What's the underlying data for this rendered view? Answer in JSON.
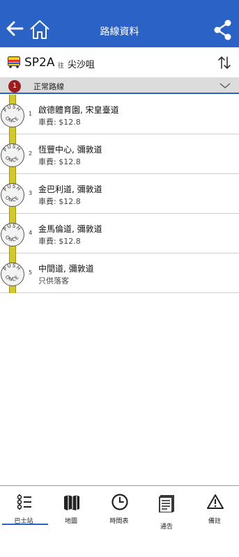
{
  "header": {
    "title": "路線資料"
  },
  "route": {
    "number": "SP2A",
    "direction_word": "往",
    "destination": "尖沙咀"
  },
  "variant": {
    "index": "1",
    "label": "正常路線"
  },
  "stops": [
    {
      "seq": "1",
      "name": "啟德體育園, 宋皇臺道",
      "fare": "車費: $12.8"
    },
    {
      "seq": "2",
      "name": "恆豐中心, 彌敦道",
      "fare": "車費: $12.8"
    },
    {
      "seq": "3",
      "name": "金巴利道, 彌敦道",
      "fare": "車費: $12.8"
    },
    {
      "seq": "4",
      "name": "金馬倫道, 彌敦道",
      "fare": "車費: $12.8"
    },
    {
      "seq": "5",
      "name": "中間道, 彌敦道",
      "fare": "只供落客"
    }
  ],
  "push_button_text": {
    "top": "PUSH",
    "bottom": "ONCE"
  },
  "tabs": [
    {
      "label": "巴士站",
      "icon": "bus-stop-list-icon",
      "active": true
    },
    {
      "label": "地圖",
      "icon": "map-icon",
      "active": false
    },
    {
      "label": "時間表",
      "icon": "clock-icon",
      "active": false
    },
    {
      "label": "通告",
      "icon": "notice-document-icon",
      "active": false
    },
    {
      "label": "備註",
      "icon": "warning-icon",
      "active": false
    }
  ],
  "colors": {
    "header_blue": "#2b62c6",
    "pole_yellow": "#d3c92a",
    "variant_badge": "#9b1d1d"
  }
}
